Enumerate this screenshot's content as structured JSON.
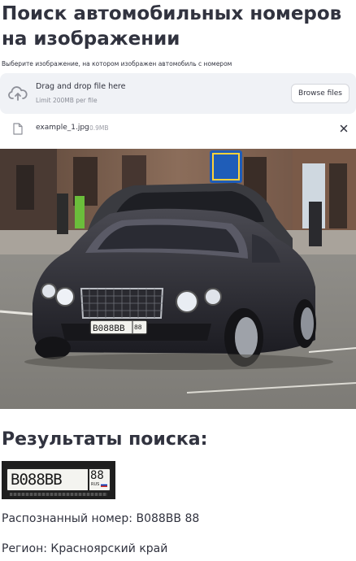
{
  "page": {
    "title": "Поиск автомобильных номеров на изображении"
  },
  "uploader": {
    "label": "Выберите изображение, на котором изображен автомобиль с номером",
    "dropzone_title": "Drag and drop file here",
    "dropzone_limit": "Limit 200MB per file",
    "browse_label": "Browse files",
    "upload_icon": "cloud-upload-icon"
  },
  "uploaded_file": {
    "name": "example_1.jpg",
    "size": "0.9MB",
    "file_icon": "file-icon",
    "remove_icon": "close-icon"
  },
  "results": {
    "heading": "Результаты поиска:",
    "plate_main": "B088BB",
    "plate_region": "88",
    "plate_country": "RUS",
    "recognized_text": "Распознанный номер: B088BB 88",
    "region_text": "Регион: Красноярский край"
  },
  "colors": {
    "text": "#31333f",
    "dropzone_bg": "#f0f2f6",
    "muted": "#8a8d97"
  }
}
